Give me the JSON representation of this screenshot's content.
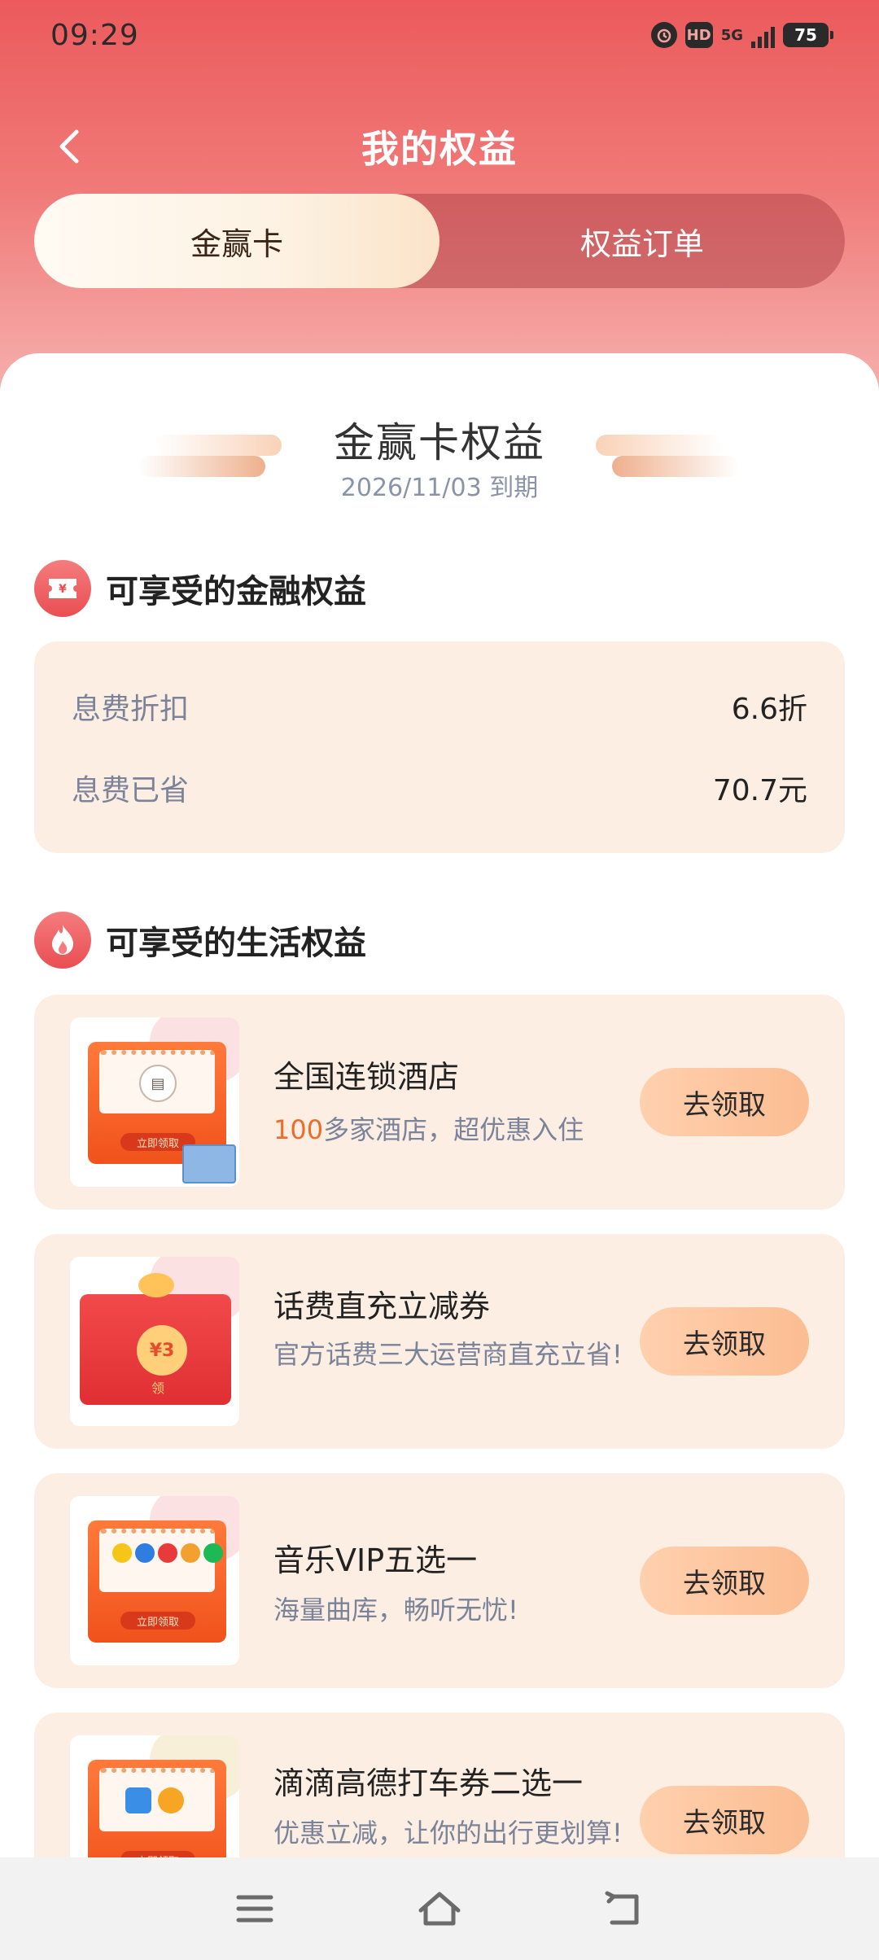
{
  "status_bar": {
    "time": "09:29",
    "hd_label": "HD",
    "network": "5G",
    "battery": "75"
  },
  "header": {
    "title": "我的权益",
    "back_icon": "chevron-left-icon"
  },
  "tabs": [
    {
      "label": "金赢卡",
      "active": true
    },
    {
      "label": "权益订单",
      "active": false
    }
  ],
  "card": {
    "title": "金赢卡权益",
    "expiry": "2026/11/03 到期"
  },
  "finance_section": {
    "title": "可享受的金融权益",
    "icon": "ticket-yen-icon",
    "rows": [
      {
        "label": "息费折扣",
        "value": "6.6折"
      },
      {
        "label": "息费已省",
        "value": "70.7元"
      }
    ]
  },
  "life_section": {
    "title": "可享受的生活权益",
    "icon": "flame-icon",
    "items": [
      {
        "title": "全国连锁酒店",
        "sub_highlight": "100",
        "sub": "多家酒店，超优惠入住",
        "button": "去领取",
        "thumb_label": "立即领取"
      },
      {
        "title": "话费直充立减券",
        "sub_highlight": "",
        "sub": "官方话费三大运营商直充立省!",
        "button": "去领取",
        "thumb_label": "¥3",
        "thumb_badge": "领"
      },
      {
        "title": "音乐VIP五选一",
        "sub_highlight": "",
        "sub": "海量曲库，畅听无忧!",
        "button": "去领取",
        "thumb_label": "立即领取"
      },
      {
        "title": "滴滴高德打车券二选一",
        "sub_highlight": "",
        "sub": "优惠立减，让你的出行更划算!",
        "button": "去领取",
        "thumb_label": "立即领取"
      }
    ]
  },
  "bottom_nav": {
    "icons": [
      "menu-icon",
      "home-icon",
      "back-icon"
    ]
  },
  "colors": {
    "header_red": "#ec5a5c",
    "card_bg": "#fdeee4",
    "button_peach": "#fbbd92",
    "highlight_orange": "#ee6b2a"
  }
}
